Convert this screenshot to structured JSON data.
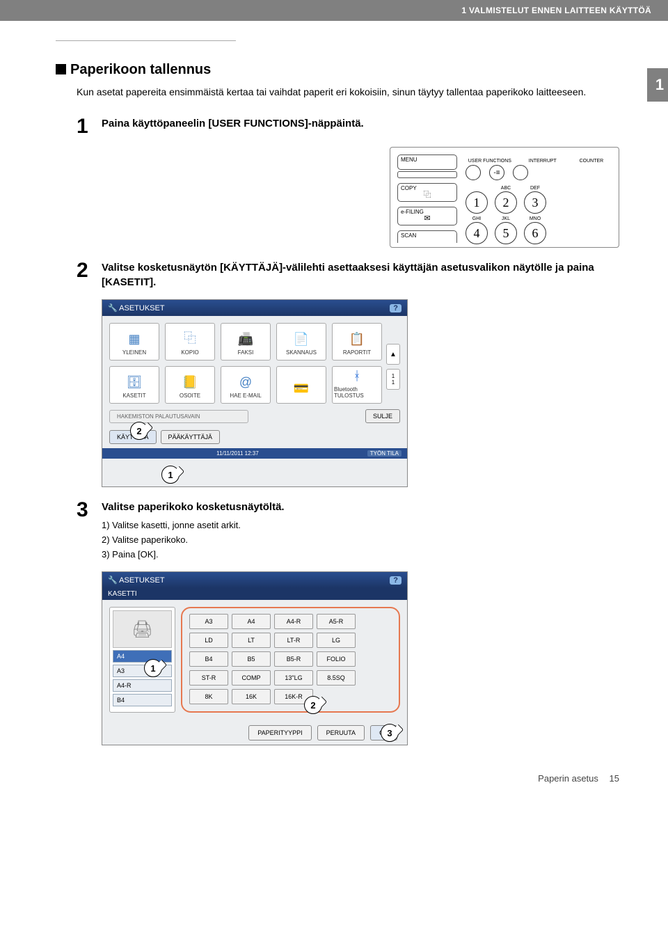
{
  "header": {
    "chapter_title": "1 VALMISTELUT ENNEN LAITTEEN KÄYTTÖÄ"
  },
  "chapter_tab": "1",
  "section": {
    "title": "Paperikoon tallennus",
    "intro": "Kun asetat papereita ensimmäistä kertaa tai vaihdat paperit eri kokoisiin, sinun täytyy tallentaa paperikoko laitteeseen."
  },
  "step1": {
    "num": "1",
    "title": "Paina käyttöpaneelin [USER FUNCTIONS]-näppäintä."
  },
  "panel": {
    "modes": {
      "menu": "MENU",
      "copy": "COPY",
      "efiling": "e-FILING",
      "scan": "SCAN"
    },
    "top": {
      "user_functions": "USER FUNCTIONS",
      "interrupt": "INTERRUPT",
      "counter": "COUNTER"
    },
    "keys": {
      "abc": "ABC",
      "def": "DEF",
      "ghi": "GHI",
      "jkl": "JKL",
      "mno": "MNO",
      "1": "1",
      "2": "2",
      "3": "3",
      "4": "4",
      "5": "5",
      "6": "6"
    }
  },
  "step2": {
    "num": "2",
    "title": "Valitse kosketusnäytön [KÄYTTÄJÄ]-välilehti asettaaksesi käyttäjän asetusvalikon näytölle ja paina [KASETIT]."
  },
  "screenshot1": {
    "titlebar": "ASETUKSET",
    "help": "?",
    "tiles": [
      "YLEINEN",
      "KOPIO",
      "FAKSI",
      "SKANNAUS",
      "RAPORTIT",
      "KASETIT",
      "OSOITE",
      "HAE E-MAIL",
      "",
      "Bluetooth TULOSTUS"
    ],
    "bottom_left_disabled": "HAKEMISTON PALAUTUSAVAIN",
    "close": "SULJE",
    "tab1": "KÄYTTÄJÄ",
    "tab2": "PÄÄKÄYTTÄJÄ",
    "footer_date": "11/11/2011 12:37",
    "footer_status": "TYÖN TILA",
    "callout_top": "2",
    "callout_bottom": "1"
  },
  "step3": {
    "num": "3",
    "title": "Valitse paperikoko kosketusnäytöltä.",
    "sub1": "1)  Valitse kasetti, jonne asetit arkit.",
    "sub2": "2)  Valitse paperikoko.",
    "sub3": "3)  Paina [OK]."
  },
  "screenshot2": {
    "titlebar": "ASETUKSET",
    "breadcrumb": "KASETTI",
    "help": "?",
    "trays": [
      "A4",
      "A3",
      "A4-R",
      "B4"
    ],
    "sizes_rows": [
      [
        "A3",
        "A4",
        "A4-R",
        "A5-R"
      ],
      [
        "LD",
        "LT",
        "LT-R",
        "LG"
      ],
      [
        "B4",
        "B5",
        "B5-R",
        "FOLIO"
      ],
      [
        "ST-R",
        "COMP",
        "13\"LG",
        "8.5SQ"
      ],
      [
        "8K",
        "16K",
        "16K-R",
        ""
      ]
    ],
    "btn_papertype": "PAPERITYYPPI",
    "btn_cancel": "PERUUTA",
    "btn_ok": "OK",
    "callout_left": "1",
    "callout_mid": "2",
    "callout_right": "3"
  },
  "footer": {
    "section": "Paperin asetus",
    "page": "15"
  }
}
